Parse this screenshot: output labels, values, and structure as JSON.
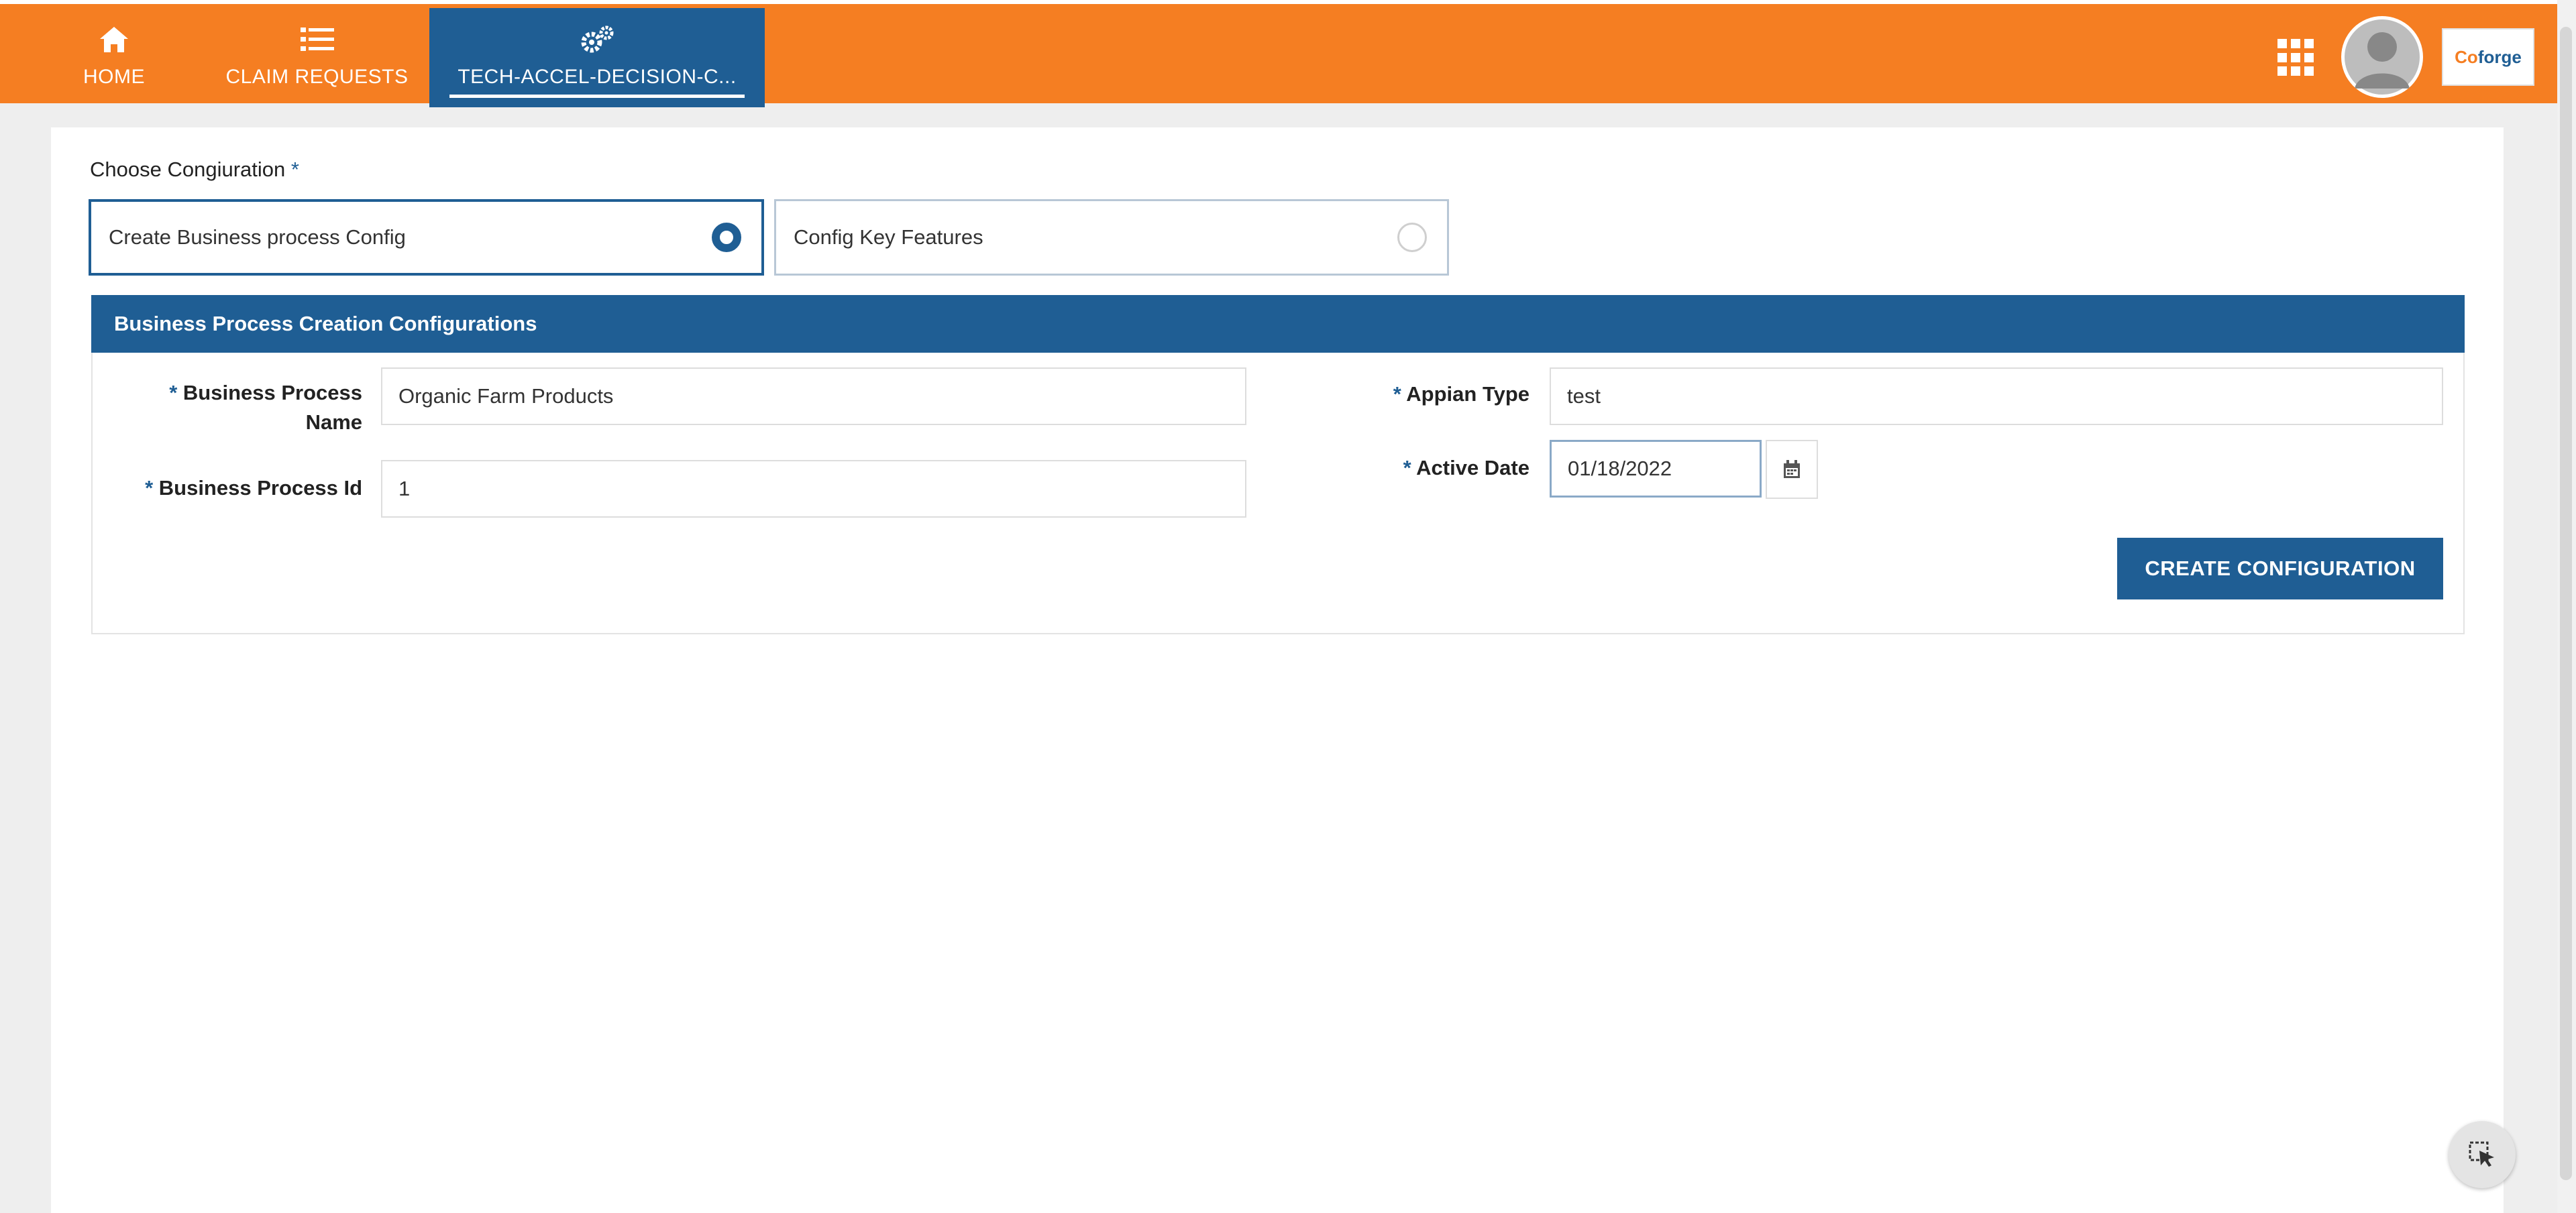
{
  "nav": {
    "tabs": [
      {
        "label": "HOME",
        "icon": "home-icon"
      },
      {
        "label": "CLAIM REQUESTS",
        "icon": "list-icon"
      },
      {
        "label": "TECH-ACCEL-DECISION-C...",
        "icon": "gears-icon",
        "active": true
      }
    ],
    "logo_text_prefix": "Co",
    "logo_text_suffix": "forge"
  },
  "config": {
    "label": "Choose Congiuration",
    "required_mark": "*",
    "options": [
      {
        "label": "Create Business process Config",
        "selected": true
      },
      {
        "label": "Config Key Features",
        "selected": false
      }
    ]
  },
  "section": {
    "title": "Business Process Creation Configurations",
    "fields": {
      "bp_name": {
        "label": "Business Process",
        "label_line2": "Name",
        "value": "Organic Farm Products"
      },
      "bp_id": {
        "label": "Business Process Id",
        "value": "1"
      },
      "appian_type": {
        "label": "Appian Type",
        "value": "test"
      },
      "active_date": {
        "label": "Active Date",
        "value": "01/18/2022"
      }
    },
    "create_button": "CREATE CONFIGURATION"
  },
  "colors": {
    "brand_orange": "#f57e22",
    "primary_blue": "#1f5e94"
  }
}
